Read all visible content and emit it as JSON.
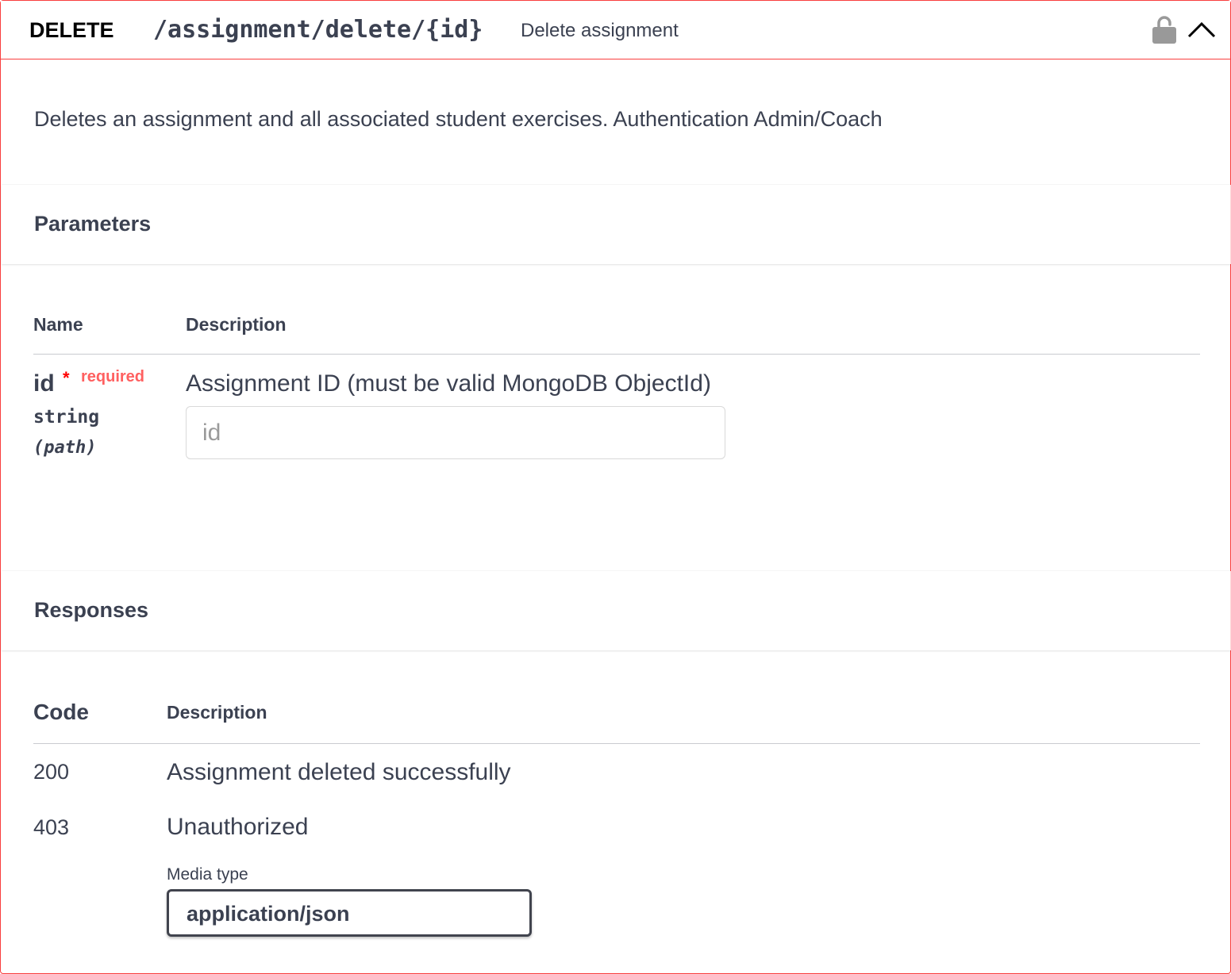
{
  "operation": {
    "method": "DELETE",
    "path": "/assignment/delete/{id}",
    "summary": "Delete assignment",
    "description": "Deletes an assignment and all associated student exercises. Authentication Admin/Coach",
    "accent_color": "#f93e3e",
    "icons": {
      "lock": "lock-open-icon",
      "collapse": "chevron-up-icon"
    }
  },
  "parameters": {
    "title": "Parameters",
    "col_name": "Name",
    "col_description": "Description",
    "items": [
      {
        "name": "id",
        "required_star": "*",
        "required_label": "required",
        "type": "string",
        "in": "(path)",
        "description": "Assignment ID (must be valid MongoDB ObjectId)",
        "placeholder": "id",
        "value": ""
      }
    ]
  },
  "responses": {
    "title": "Responses",
    "col_code": "Code",
    "col_description": "Description",
    "items": [
      {
        "code": "200",
        "description": "Assignment deleted successfully"
      },
      {
        "code": "403",
        "description": "Unauthorized"
      }
    ],
    "media_type_label": "Media type",
    "media_type_value": "application/json"
  }
}
